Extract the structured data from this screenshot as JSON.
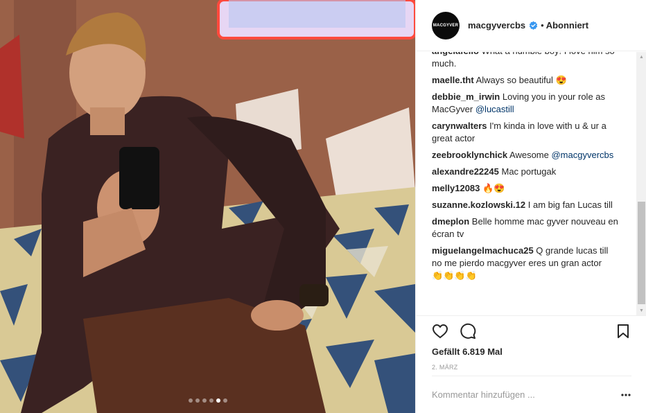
{
  "post": {
    "username": "macgyvercbs",
    "avatar_text": "MACGYVER",
    "separator": "•",
    "follow_status": "Abonniert",
    "likes": "Gefällt 6.819 Mal",
    "date": "2. MÄRZ",
    "comment_placeholder": "Kommentar hinzufügen ..."
  },
  "comments": [
    {
      "user": "angelafello",
      "text": "What a humble boy! I love him so much.",
      "mention": "",
      "after": ""
    },
    {
      "user": "maelle.tht",
      "text": "Always so beautiful 😍",
      "mention": "",
      "after": ""
    },
    {
      "user": "debbie_m_irwin",
      "text": "Loving you in your role as MacGyver",
      "mention": "@lucastill",
      "after": ""
    },
    {
      "user": "carynwalters",
      "text": "I'm kinda in love with u & ur a great actor",
      "mention": "",
      "after": ""
    },
    {
      "user": "zeebrooklynchick",
      "text": "Awesome",
      "mention": "@macgyvercbs",
      "after": ""
    },
    {
      "user": "alexandre22245",
      "text": "Mac portugak",
      "mention": "",
      "after": ""
    },
    {
      "user": "melly12083",
      "text": "🔥😍",
      "mention": "",
      "after": ""
    },
    {
      "user": "suzanne.kozlowski.12",
      "text": "I am big fan Lucas till",
      "mention": "",
      "after": ""
    },
    {
      "user": "dmeplon",
      "text": "Belle homme mac gyver nouveau en écran tv",
      "mention": "",
      "after": ""
    },
    {
      "user": "miguelangelmachuca25",
      "text": "Q grande lucas till no me pierdo macgyver eres un gran actor",
      "mention": "",
      "after": "👏👏👏👏"
    }
  ],
  "carousel": {
    "count": 6,
    "active_index": 4
  },
  "colors": {
    "verified": "#3897f0",
    "mention": "#003569",
    "border": "#efefef"
  },
  "icons": [
    "heart-icon",
    "comment-icon",
    "bookmark-icon",
    "more-options-icon",
    "verified-badge-icon"
  ]
}
